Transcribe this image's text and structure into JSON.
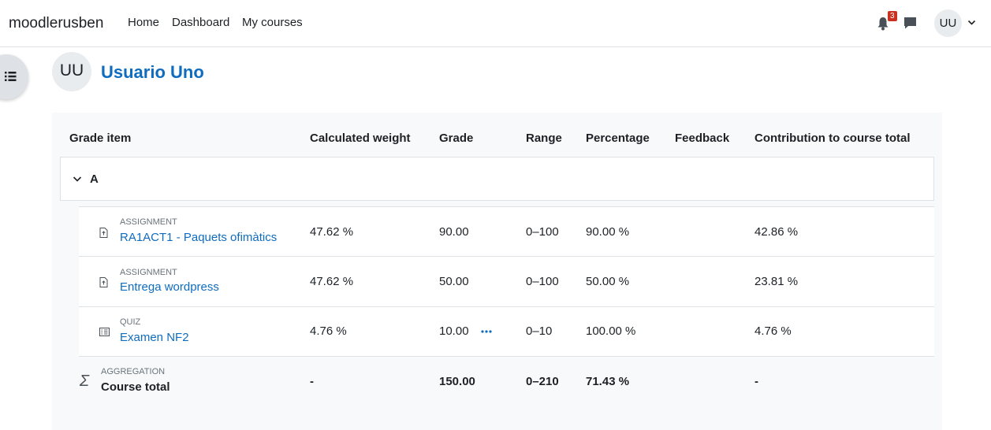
{
  "site": {
    "name": "moodlerusben"
  },
  "nav": {
    "home": "Home",
    "dashboard": "Dashboard",
    "my_courses": "My courses"
  },
  "notifications": {
    "count": "3"
  },
  "user": {
    "initials": "UU",
    "full_name": "Usuario Uno"
  },
  "table": {
    "headers": {
      "grade_item": "Grade item",
      "calculated_weight": "Calculated weight",
      "grade": "Grade",
      "range": "Range",
      "percentage": "Percentage",
      "feedback": "Feedback",
      "contribution": "Contribution to course total"
    },
    "category": {
      "name": "A"
    },
    "items": [
      {
        "type": "ASSIGNMENT",
        "name": "RA1ACT1 - Paquets ofimàtics",
        "weight": "47.62 %",
        "grade": "90.00",
        "range": "0–100",
        "percentage": "90.00 %",
        "feedback": "",
        "contribution": "42.86 %",
        "icon": "assignment-icon"
      },
      {
        "type": "ASSIGNMENT",
        "name": "Entrega wordpress",
        "weight": "47.62 %",
        "grade": "50.00",
        "range": "0–100",
        "percentage": "50.00 %",
        "feedback": "",
        "contribution": "23.81 %",
        "icon": "assignment-icon"
      },
      {
        "type": "QUIZ",
        "name": "Examen NF2",
        "weight": "4.76 %",
        "grade": "10.00",
        "range": "0–10",
        "percentage": "100.00 %",
        "feedback": "",
        "contribution": "4.76 %",
        "icon": "quiz-icon"
      }
    ],
    "total": {
      "type": "AGGREGATION",
      "name": "Course total",
      "weight": "-",
      "grade": "150.00",
      "range": "0–210",
      "percentage": "71.43 %",
      "contribution": "-"
    }
  },
  "colors": {
    "link": "#0f6cbf",
    "badge": "#ca3120",
    "panel_bg": "#f8f9fa"
  }
}
